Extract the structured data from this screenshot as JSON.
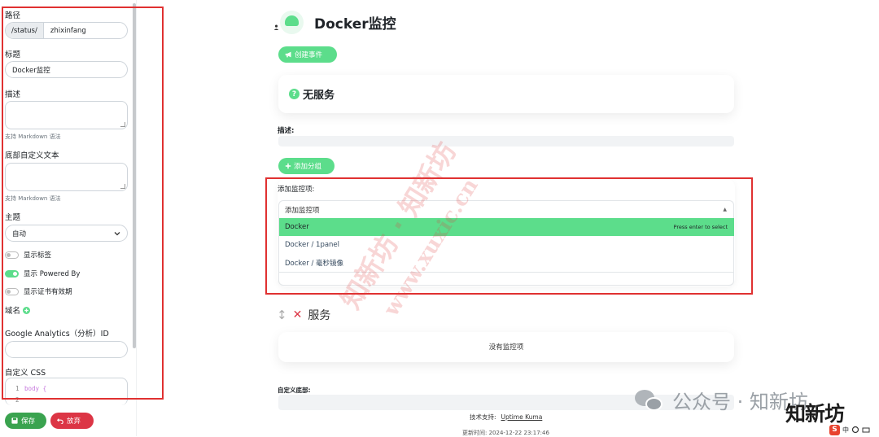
{
  "sidebar": {
    "path_label": "路径",
    "path_prefix": "/status/",
    "path_value": "zhixinfang",
    "title_label": "标题",
    "title_value": "Docker监控",
    "desc_label": "描述",
    "markdown_hint": "支持 Markdown 语法",
    "footer_label": "底部自定义文本",
    "markdown_hint2": "支持 Markdown 语法",
    "theme_label": "主题",
    "theme_value": "自动",
    "toggle_tags": "显示标签",
    "toggle_powered": "显示 Powered By",
    "toggle_cert": "显示证书有效期",
    "domain_label": "域名",
    "ga_label": "Google Analytics（分析）ID",
    "css_label": "自定义 CSS",
    "css_lines": [
      {
        "n": "1",
        "code": "body {"
      },
      {
        "n": "2",
        "code": ""
      }
    ],
    "save_label": "保存",
    "cancel_label": "放弃"
  },
  "main": {
    "page_title": "Docker监控",
    "create_incident_label": "创建事件",
    "status_title": "无服务",
    "desc_label": "描述:",
    "add_group_label": "添加分组",
    "add_monitor_label": "添加监控项:",
    "monitor_placeholder": "添加监控项",
    "enter_hint": "Press enter to select",
    "options": [
      "Docker",
      "Docker / 1panel",
      "Docker / 毫秒镜像"
    ],
    "group_name": "服务",
    "empty_text": "没有监控项",
    "custom_footer_label": "自定义底部:",
    "powered_by_label": "技术支持:",
    "powered_by_link": "Uptime Kuma",
    "updated_text": "更新时间: 2024-12-22 23:17:46"
  },
  "overlay": {
    "watermark_1": "知新坊 · 知新坊",
    "watermark_2": "www.xuxic.cn",
    "wechat_text": "公众号 · 知新坊",
    "brand_text": "知新坊",
    "ime_text": "中"
  },
  "colors": {
    "primary_green": "#5cdd8b",
    "danger": "#dc3545",
    "save_green": "#3aa34f",
    "highlight_box": "#e03131"
  }
}
